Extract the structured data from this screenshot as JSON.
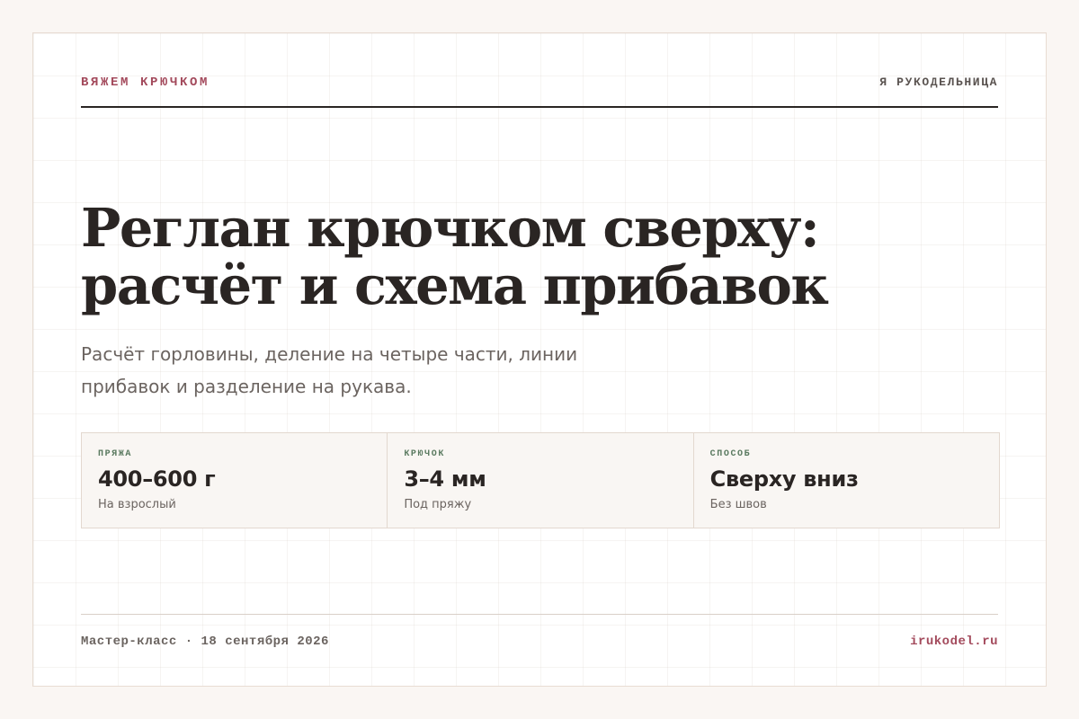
{
  "header": {
    "brand": "ВЯЖЕМ КРЮЧКОМ",
    "site_name": "Я РУКОДЕЛЬНИЦА"
  },
  "hero": {
    "title_lines": [
      "Реглан крючком сверху:",
      "расчёт и схема прибавок"
    ],
    "subtitle_lines": [
      "Расчёт горловины, деление на четыре части, линии",
      "прибавок и разделение на рукава."
    ]
  },
  "specs": [
    {
      "label": "ПРЯЖА",
      "value": "400–600 г",
      "note": "На взрослый"
    },
    {
      "label": "КРЮЧОК",
      "value": "3–4 мм",
      "note": "Под пряжу"
    },
    {
      "label": "СПОСОБ",
      "value": "Сверху вниз",
      "note": "Без швов"
    }
  ],
  "footer": {
    "meta": "Мастер-класс · 18 сентября 2026",
    "site": "irukodel.ru"
  },
  "colors": {
    "accent": "#a34a5c",
    "label_green": "#5a7a60",
    "text_dark": "#2a2523",
    "text_muted": "#6b6460",
    "page_bg": "#faf6f3"
  }
}
